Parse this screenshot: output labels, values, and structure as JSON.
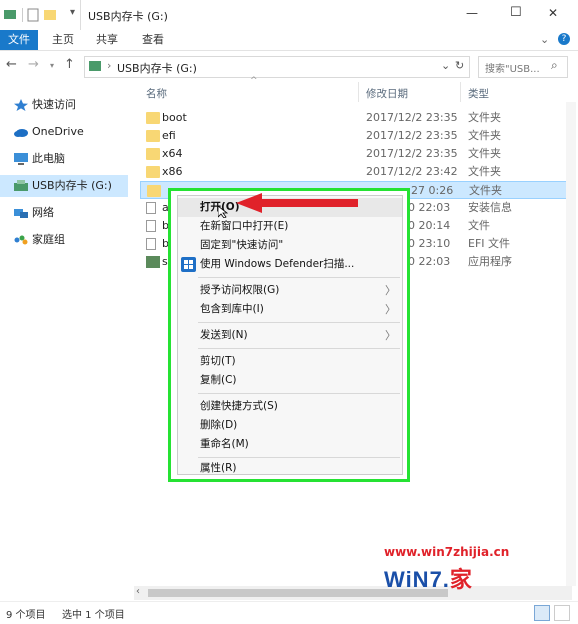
{
  "window": {
    "title": "USB内存卡 (G:)",
    "minimize_glyph": "—",
    "maximize_glyph": "☐",
    "close_glyph": "✕"
  },
  "ribbon": {
    "tabs": [
      {
        "label": "文件",
        "active": true
      },
      {
        "label": "主页"
      },
      {
        "label": "共享"
      },
      {
        "label": "查看"
      }
    ],
    "expand_glyph": "⌄",
    "help_glyph": "?"
  },
  "address": {
    "path": "USB内存卡 (G:)",
    "search_placeholder": "搜索\"USB...",
    "back_glyph": "←",
    "forward_glyph": "→",
    "up_glyph": "↑",
    "refresh_glyph": "↻",
    "dropdown_glyph": "⌄",
    "search_glyph": "⌕"
  },
  "nav": {
    "items": [
      {
        "label": "快速访问",
        "icon": "star-icon"
      },
      {
        "label": "OneDrive",
        "icon": "cloud-icon"
      },
      {
        "label": "此电脑",
        "icon": "computer-icon"
      },
      {
        "label": "USB内存卡 (G:)",
        "icon": "usb-drive-icon",
        "selected": true
      },
      {
        "label": "网络",
        "icon": "network-icon"
      },
      {
        "label": "家庭组",
        "icon": "homegroup-icon"
      }
    ]
  },
  "columns": {
    "name": "名称",
    "date": "修改日期",
    "type": "类型"
  },
  "files": [
    {
      "name": "boot",
      "date": "2017/12/2 23:35",
      "type": "文件夹",
      "kind": "folder"
    },
    {
      "name": "efi",
      "date": "2017/12/2 23:35",
      "type": "文件夹",
      "kind": "folder"
    },
    {
      "name": "x64",
      "date": "2017/12/2 23:35",
      "type": "文件夹",
      "kind": "folder"
    },
    {
      "name": "x86",
      "date": "2017/12/2 23:42",
      "type": "文件夹",
      "kind": "folder"
    },
    {
      "name": "",
      "date": "27 0:26",
      "type": "文件夹",
      "kind": "folder",
      "selected": true
    },
    {
      "name": "a",
      "date": "0 22:03",
      "type": "安装信息",
      "kind": "file"
    },
    {
      "name": "b",
      "date": "0 20:14",
      "type": "文件",
      "kind": "file"
    },
    {
      "name": "b",
      "date": "0 23:10",
      "type": "EFI 文件",
      "kind": "file"
    },
    {
      "name": "s",
      "date": "0 22:03",
      "type": "应用程序",
      "kind": "app"
    }
  ],
  "context_menu": {
    "groups": [
      [
        {
          "label": "打开(O)",
          "bold": true
        },
        {
          "label": "在新窗口中打开(E)"
        },
        {
          "label": "固定到\"快速访问\""
        },
        {
          "label": "使用 Windows Defender扫描...",
          "icon": "windows-defender-icon"
        }
      ],
      [
        {
          "label": "授予访问权限(G)",
          "submenu": true
        },
        {
          "label": "包含到库中(I)",
          "submenu": true
        }
      ],
      [
        {
          "label": "发送到(N)",
          "submenu": true
        }
      ],
      [
        {
          "label": "剪切(T)"
        },
        {
          "label": "复制(C)"
        }
      ],
      [
        {
          "label": "创建快捷方式(S)"
        },
        {
          "label": "删除(D)"
        },
        {
          "label": "重命名(M)"
        }
      ],
      [
        {
          "label": "属性(R)"
        }
      ]
    ],
    "submenu_glyph": "〉"
  },
  "status": {
    "item_count": "9 个项目",
    "selected": "选中 1 个项目"
  },
  "watermark": {
    "url": "www.win7zhijia.cn",
    "brand": "WiN7.",
    "brand_suffix": "家"
  },
  "colors": {
    "accent": "#1979ca",
    "highlight_border": "#25e233",
    "arrow": "#e0222a",
    "selection": "#cce8ff"
  }
}
